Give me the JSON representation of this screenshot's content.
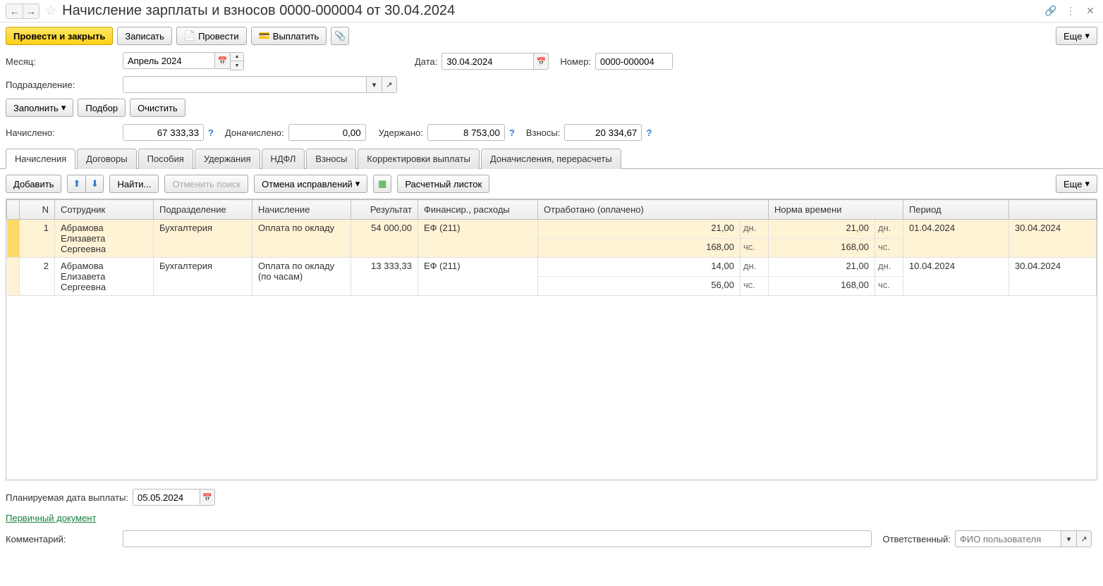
{
  "header": {
    "title": "Начисление зарплаты и взносов 0000-000004 от 30.04.2024"
  },
  "toolbar": {
    "post_close": "Провести и закрыть",
    "save": "Записать",
    "post": "Провести",
    "pay": "Выплатить",
    "more": "Еще"
  },
  "form": {
    "month_label": "Месяц:",
    "month_value": "Апрель 2024",
    "date_label": "Дата:",
    "date_value": "30.04.2024",
    "number_label": "Номер:",
    "number_value": "0000-000004",
    "department_label": "Подразделение:",
    "department_value": "",
    "fill": "Заполнить",
    "select": "Подбор",
    "clear": "Очистить"
  },
  "totals": {
    "accrued_label": "Начислено:",
    "accrued_value": "67 333,33",
    "additional_label": "Доначислено:",
    "additional_value": "0,00",
    "withheld_label": "Удержано:",
    "withheld_value": "8 753,00",
    "contributions_label": "Взносы:",
    "contributions_value": "20 334,67"
  },
  "tabs": {
    "accruals": "Начисления",
    "contracts": "Договоры",
    "benefits": "Пособия",
    "deductions": "Удержания",
    "ndfl": "НДФЛ",
    "contributions": "Взносы",
    "corrections": "Корректировки выплаты",
    "recalc": "Доначисления, перерасчеты"
  },
  "tab_toolbar": {
    "add": "Добавить",
    "find": "Найти...",
    "cancel_find": "Отменить поиск",
    "cancel_corrections": "Отмена исправлений",
    "payslip": "Расчетный листок",
    "more": "Еще"
  },
  "table": {
    "headers": {
      "n": "N",
      "employee": "Сотрудник",
      "department": "Подразделение",
      "accrual": "Начисление",
      "result": "Результат",
      "financing": "Финансир., расходы",
      "worked": "Отработано (оплачено)",
      "norm": "Норма времени",
      "period": "Период"
    },
    "rows": [
      {
        "n": "1",
        "employee": "Абрамова Елизавета Сергеевна",
        "department": "Бухгалтерия",
        "accrual": "Оплата по окладу",
        "result": "54 000,00",
        "financing": "ЕФ (211)",
        "worked_days": "21,00",
        "worked_days_unit": "дн.",
        "worked_hours": "168,00",
        "worked_hours_unit": "чс.",
        "norm_days": "21,00",
        "norm_days_unit": "дн.",
        "norm_hours": "168,00",
        "norm_hours_unit": "чс.",
        "period_from": "01.04.2024",
        "period_to": "30.04.2024",
        "highlighted": true
      },
      {
        "n": "2",
        "employee": "Абрамова Елизавета Сергеевна",
        "department": "Бухгалтерия",
        "accrual": "Оплата по окладу (по часам)",
        "result": "13 333,33",
        "financing": "ЕФ (211)",
        "worked_days": "14,00",
        "worked_days_unit": "дн.",
        "worked_hours": "56,00",
        "worked_hours_unit": "чс.",
        "norm_days": "21,00",
        "norm_days_unit": "дн.",
        "norm_hours": "168,00",
        "norm_hours_unit": "чс.",
        "period_from": "10.04.2024",
        "period_to": "30.04.2024",
        "highlighted": false
      }
    ]
  },
  "footer": {
    "planned_date_label": "Планируемая дата выплаты:",
    "planned_date_value": "05.05.2024",
    "primary_doc": "Первичный документ",
    "comment_label": "Комментарий:",
    "responsible_label": "Ответственный:",
    "responsible_placeholder": "ФИО пользователя"
  }
}
